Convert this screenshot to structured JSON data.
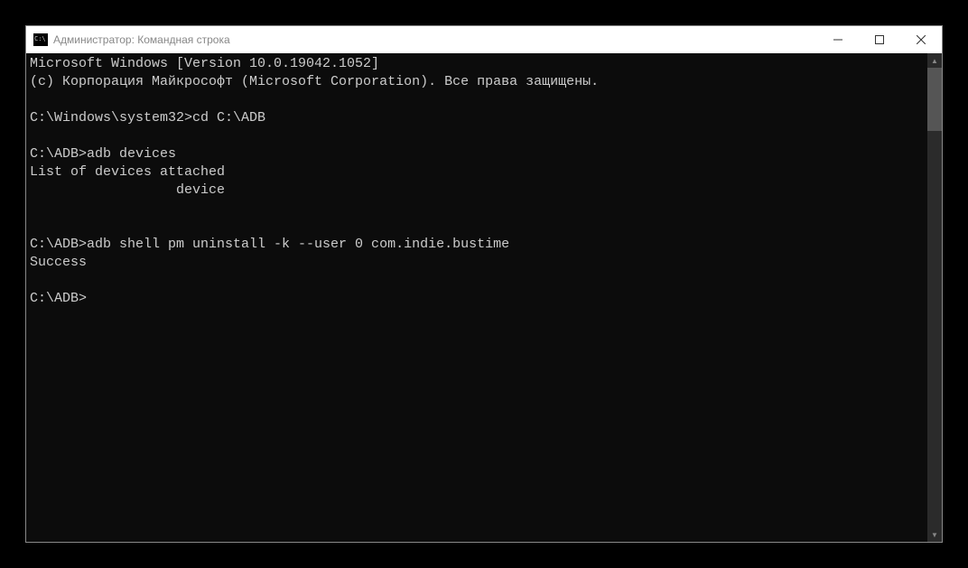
{
  "titlebar": {
    "title": "Администратор: Командная строка"
  },
  "console": {
    "lines": [
      "Microsoft Windows [Version 10.0.19042.1052]",
      "(c) Корпорация Майкрософт (Microsoft Corporation). Все права защищены.",
      "",
      "C:\\Windows\\system32>cd C:\\ADB",
      "",
      "C:\\ADB>adb devices",
      "List of devices attached",
      "                  device",
      "",
      "",
      "C:\\ADB>adb shell pm uninstall -k --user 0 com.indie.bustime",
      "Success",
      "",
      "C:\\ADB>"
    ]
  }
}
